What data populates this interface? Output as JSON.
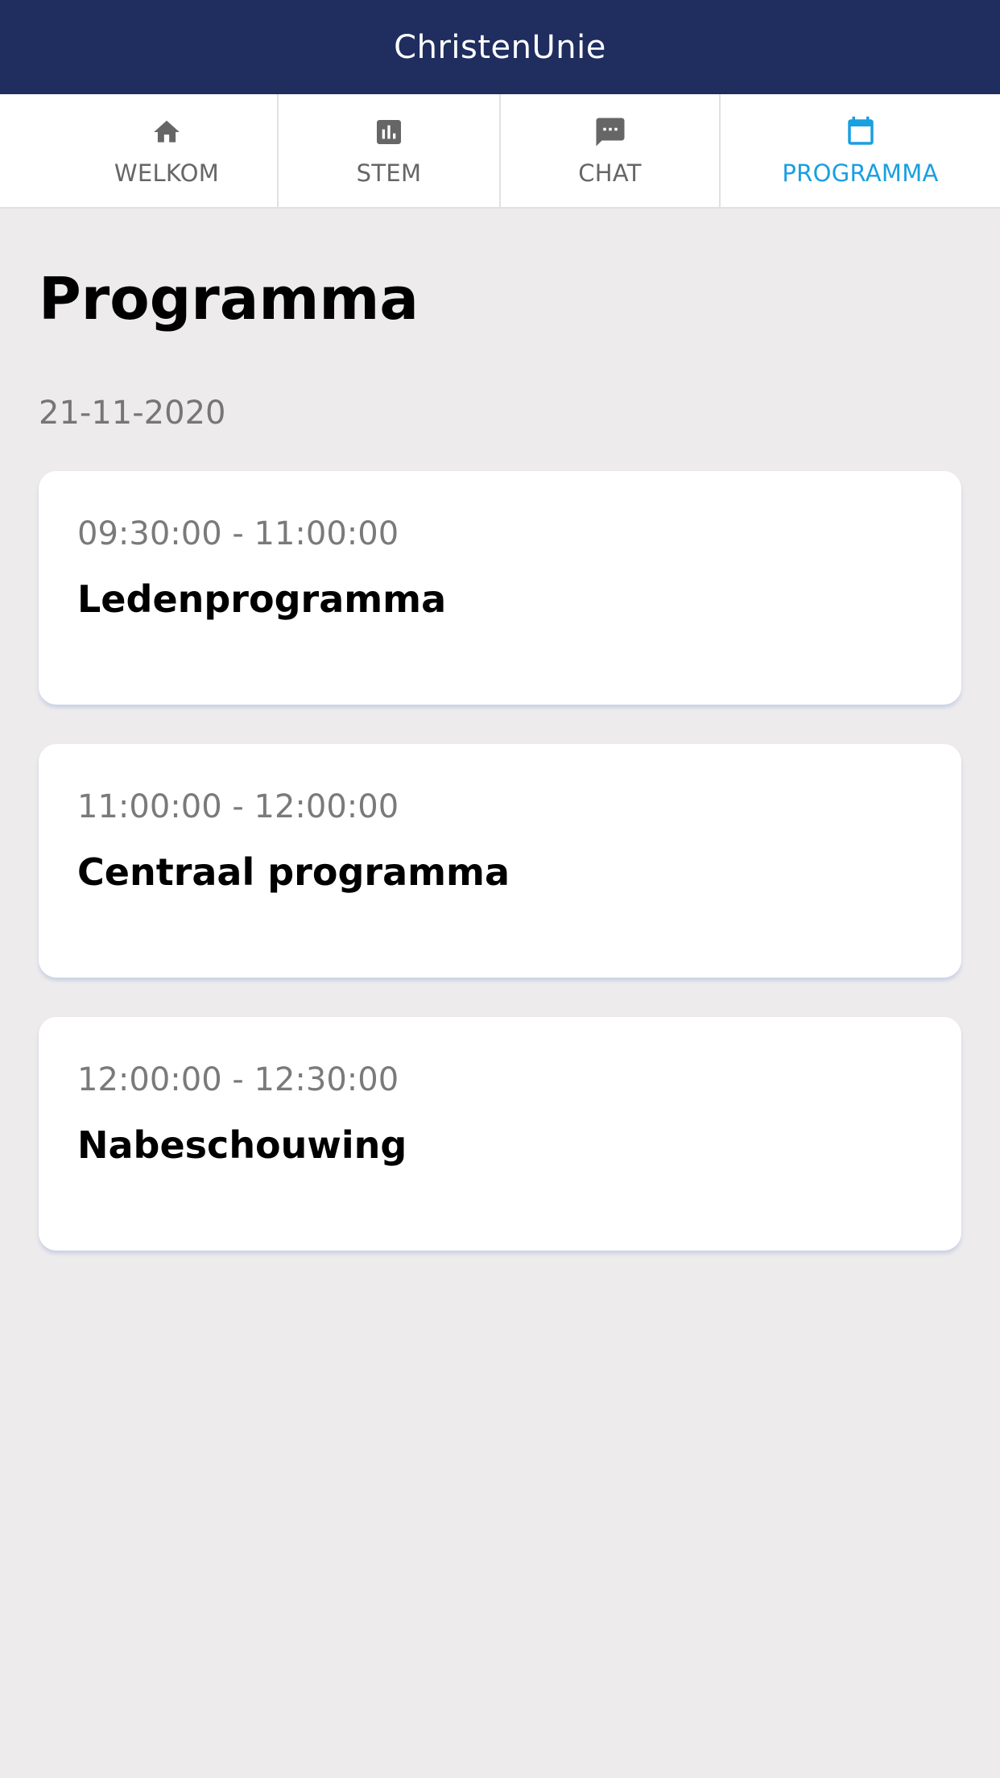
{
  "header": {
    "title": "ChristenUnie"
  },
  "tabs": [
    {
      "label": "WELKOM",
      "icon": "home-icon"
    },
    {
      "label": "STEM",
      "icon": "poll-icon"
    },
    {
      "label": "CHAT",
      "icon": "chat-icon"
    },
    {
      "label": "PROGRAMMA",
      "icon": "calendar-icon",
      "active": true
    }
  ],
  "colors": {
    "header_bg": "#1f2d5f",
    "active_tab": "#1a9fe0",
    "inactive_tab": "#666666",
    "background": "#edebec"
  },
  "page": {
    "title": "Programma",
    "date": "21-11-2020"
  },
  "sessions": [
    {
      "time": "09:30:00 - 11:00:00",
      "title": "Ledenprogramma"
    },
    {
      "time": "11:00:00 - 12:00:00",
      "title": "Centraal programma"
    },
    {
      "time": "12:00:00 - 12:30:00",
      "title": "Nabeschouwing"
    }
  ]
}
